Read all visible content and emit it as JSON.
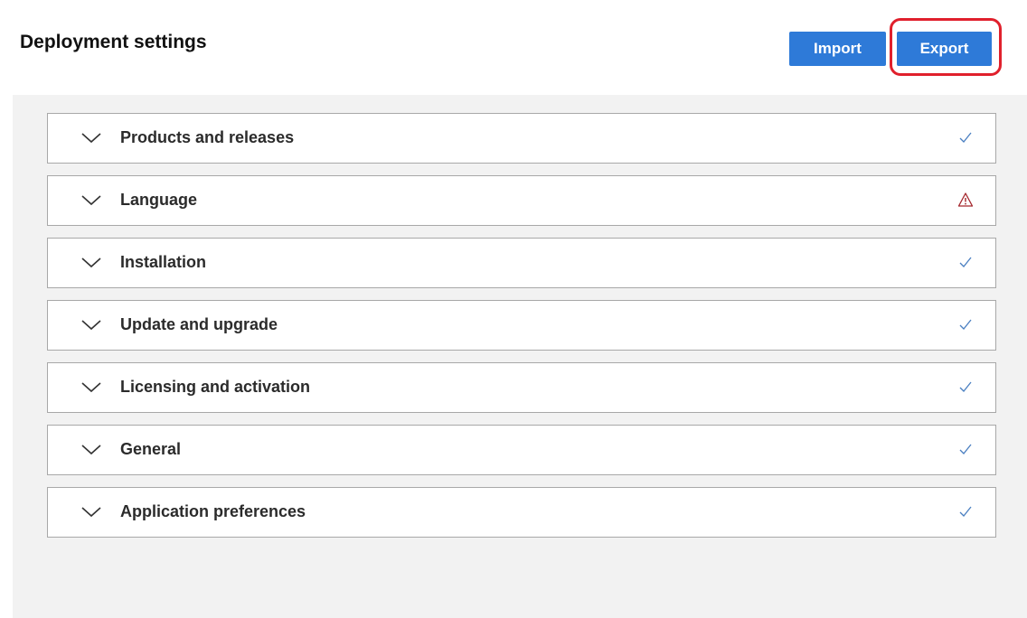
{
  "header": {
    "title": "Deployment settings",
    "import_label": "Import",
    "export_label": "Export"
  },
  "sections": [
    {
      "label": "Products and releases",
      "status": "check-icon"
    },
    {
      "label": "Language",
      "status": "warning-icon"
    },
    {
      "label": "Installation",
      "status": "check-icon"
    },
    {
      "label": "Update and upgrade",
      "status": "check-icon"
    },
    {
      "label": "Licensing and activation",
      "status": "check-icon"
    },
    {
      "label": "General",
      "status": "check-icon"
    },
    {
      "label": "Application preferences",
      "status": "check-icon"
    }
  ],
  "colors": {
    "button": "#2e7ad8",
    "highlight": "#e0202c",
    "check": "#4a7fc1",
    "warning": "#a4262c",
    "panel_bg": "#f2f2f2"
  }
}
